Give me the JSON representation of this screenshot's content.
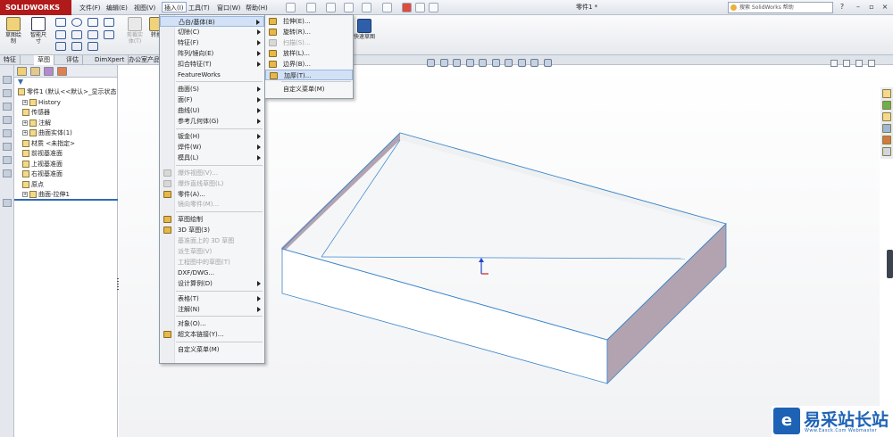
{
  "app": {
    "brand": "SOLIDWORKS",
    "doc_title": "零件1 *"
  },
  "menubar": [
    {
      "label": "文件(F)"
    },
    {
      "label": "编辑(E)"
    },
    {
      "label": "视图(V)"
    },
    {
      "label": "插入(I)",
      "active": true
    },
    {
      "label": "工具(T)"
    },
    {
      "label": "窗口(W)"
    },
    {
      "label": "帮助(H)"
    }
  ],
  "search": {
    "placeholder": "搜索 SolidWorks 帮助"
  },
  "command_manager": {
    "big_tools": [
      {
        "label": "草图绘制"
      },
      {
        "label": "智能尺寸"
      },
      {
        "label": "剪裁实体(T)"
      },
      {
        "label": "转换"
      }
    ],
    "right_tool": "快速草图"
  },
  "tabs": [
    {
      "label": "特征"
    },
    {
      "label": "草图",
      "active": true
    },
    {
      "label": "评估"
    },
    {
      "label": "DimXpert"
    },
    {
      "label": "办公室产品"
    }
  ],
  "feature_tree": [
    {
      "label": "零件1 (默认<<默认>_显示状态",
      "indent": 0
    },
    {
      "label": "History",
      "indent": 1,
      "expand": true
    },
    {
      "label": "传感器",
      "indent": 1
    },
    {
      "label": "注解",
      "indent": 1,
      "expand": true
    },
    {
      "label": "曲面实体(1)",
      "indent": 1,
      "expand": true
    },
    {
      "label": "材质 <未指定>",
      "indent": 1
    },
    {
      "label": "前视基准面",
      "indent": 1
    },
    {
      "label": "上视基准面",
      "indent": 1
    },
    {
      "label": "右视基准面",
      "indent": 1
    },
    {
      "label": "原点",
      "indent": 1
    },
    {
      "label": "曲面-拉伸1",
      "indent": 1,
      "expand": true
    }
  ],
  "insert_menu": [
    {
      "label": "凸台/基体(B)",
      "arrow": true,
      "highlight": true
    },
    {
      "label": "切除(C)",
      "arrow": true
    },
    {
      "label": "特征(F)",
      "arrow": true
    },
    {
      "label": "阵列/镜向(E)",
      "arrow": true
    },
    {
      "label": "扣合特征(T)",
      "arrow": true
    },
    {
      "label": "FeatureWorks"
    },
    {
      "sep": true
    },
    {
      "label": "曲面(S)",
      "arrow": true
    },
    {
      "label": "面(F)",
      "arrow": true
    },
    {
      "label": "曲线(U)",
      "arrow": true
    },
    {
      "label": "参考几何体(G)",
      "arrow": true
    },
    {
      "sep": true
    },
    {
      "label": "钣金(H)",
      "arrow": true
    },
    {
      "label": "焊件(W)",
      "arrow": true
    },
    {
      "label": "模具(L)",
      "arrow": true
    },
    {
      "sep": true
    },
    {
      "label": "爆炸视图(V)...",
      "disabled": true,
      "icon": "explode-icon"
    },
    {
      "label": "爆炸直线草图(L)",
      "disabled": true,
      "icon": "explode-line-icon"
    },
    {
      "label": "零件(A)...",
      "icon": "part-icon"
    },
    {
      "label": "镜向零件(M)...",
      "disabled": true
    },
    {
      "sep": true
    },
    {
      "label": "草图绘制",
      "icon": "sketch-icon"
    },
    {
      "label": "3D 草图(3)",
      "icon": "sketch3d-icon"
    },
    {
      "label": "基准面上的 3D 草图",
      "disabled": true
    },
    {
      "label": "派生草图(V)",
      "disabled": true
    },
    {
      "label": "工程图中的草图(T)",
      "disabled": true
    },
    {
      "label": "DXF/DWG..."
    },
    {
      "label": "设计算例(D)",
      "arrow": true
    },
    {
      "sep": true
    },
    {
      "label": "表格(T)",
      "arrow": true
    },
    {
      "label": "注解(N)",
      "arrow": true
    },
    {
      "sep": true
    },
    {
      "label": "对象(O)..."
    },
    {
      "label": "超文本链接(Y)...",
      "icon": "globe-icon"
    },
    {
      "sep": true
    },
    {
      "label": "自定义菜单(M)"
    }
  ],
  "submenu": [
    {
      "label": "拉伸(E)...",
      "icon": "extrude-icon"
    },
    {
      "label": "旋转(R)...",
      "icon": "revolve-icon"
    },
    {
      "label": "扫描(S)...",
      "disabled": true,
      "icon": "sweep-icon"
    },
    {
      "label": "放样(L)...",
      "icon": "loft-icon"
    },
    {
      "label": "边界(B)...",
      "icon": "boundary-icon"
    },
    {
      "label": "加厚(T)...",
      "icon": "thicken-icon",
      "highlight": true
    },
    {
      "sep": true
    },
    {
      "label": "自定义菜单(M)"
    }
  ],
  "watermark": {
    "glyph": "e",
    "text": "易采站长站",
    "sub": "Www.Easck.Com  Webmaster"
  },
  "colors": {
    "brand": "#b11a1a",
    "highlight": "#d2e1f5",
    "wall_inner": "#b3a3b0",
    "edge": "#3b86c9",
    "watermark": "#1d62b5"
  }
}
